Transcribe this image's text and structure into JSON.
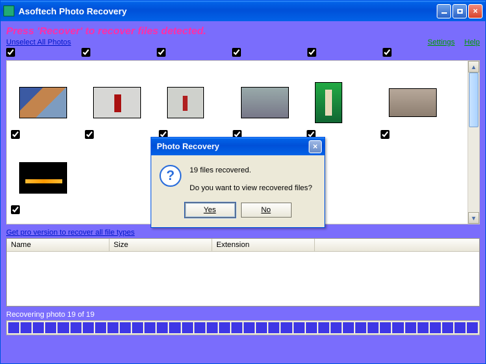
{
  "window": {
    "title": "Asoftech Photo Recovery"
  },
  "instruction": "Press 'Recover' to recover files detected.",
  "links": {
    "unselect": "Unselect All Photos",
    "settings": "Settings",
    "help": "Help",
    "pro": "Get pro version to recover all file types"
  },
  "table": {
    "col_name": "Name",
    "col_size": "Size",
    "col_ext": "Extension"
  },
  "status": "Recovering photo 19 of 19",
  "progress": {
    "segments": 38
  },
  "dialog": {
    "title": "Photo Recovery",
    "line1": "19 files recovered.",
    "line2": "Do you want to view recovered files?",
    "yes": "Yes",
    "no": "No"
  },
  "thumbs": {
    "top_checks": 6,
    "row1_count": 6,
    "row2_count": 1
  }
}
